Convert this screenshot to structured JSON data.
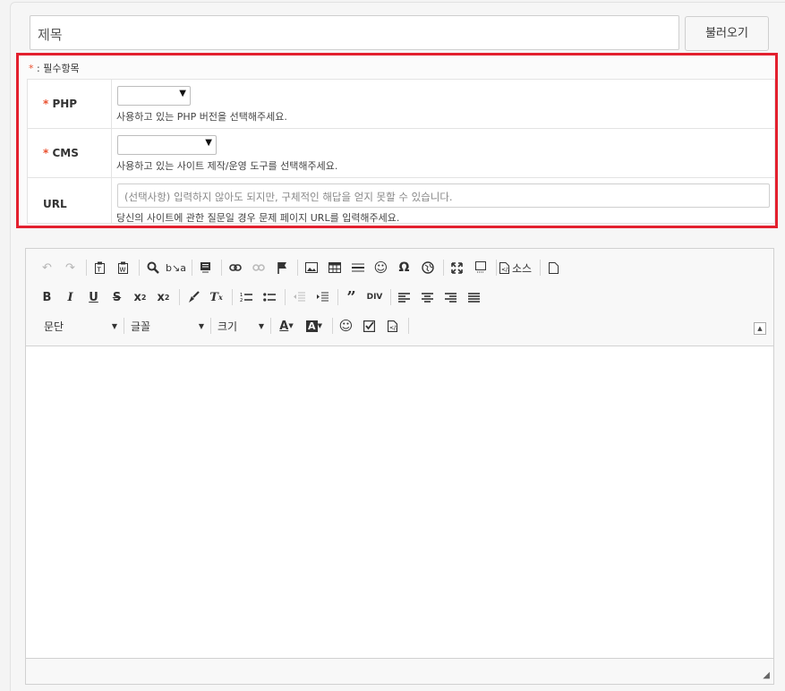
{
  "title_input": {
    "placeholder": "제목"
  },
  "load_button": "불러오기",
  "required_note": {
    "star": "*",
    "text": " : 필수항목"
  },
  "fields": {
    "php": {
      "star": "*",
      "label": "PHP",
      "help": "사용하고 있는 PHP 버전을 선택해주세요."
    },
    "cms": {
      "star": "*",
      "label": "CMS",
      "help": "사용하고 있는 사이트 제작/운영 도구를 선택해주세요."
    },
    "url": {
      "label": "URL",
      "placeholder": "(선택사항) 입력하지 않아도 되지만, 구체적인 해답을 얻지 못할 수 있습니다.",
      "help": "당신의 사이트에 관한 질문일 경우 문제 페이지 URL를 입력해주세요."
    }
  },
  "toolbar": {
    "source_label": "소스",
    "format_combo": "문단",
    "font_combo": "글꼴",
    "size_combo": "크기"
  },
  "colors": {
    "required_box": "#e3202e",
    "star": "#e94f2e"
  }
}
